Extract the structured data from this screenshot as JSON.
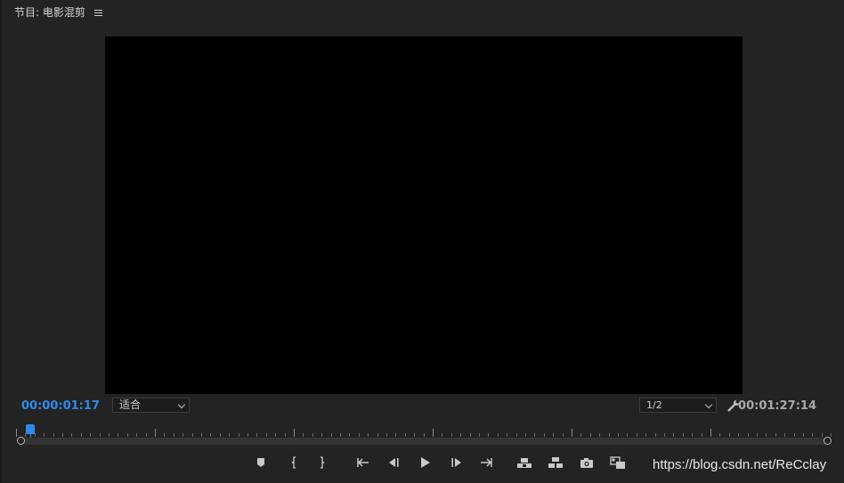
{
  "panel": {
    "title": "节目: 电影混剪",
    "menu_icon": "hamburger-menu-icon"
  },
  "timecodes": {
    "current": "00:00:01:17",
    "duration": "00:01:27:14",
    "current_color": "#2d8ceb",
    "duration_color": "#a9a9a9"
  },
  "zoom_select": {
    "value": "适合"
  },
  "resolution_select": {
    "value": "1/2"
  },
  "settings_icon": "wrench-icon",
  "transport": [
    {
      "name": "add-marker",
      "icon": "marker-icon"
    },
    {
      "name": "mark-in",
      "icon": "mark-in-icon"
    },
    {
      "name": "mark-out",
      "icon": "mark-out-icon"
    },
    {
      "name": "go-to-in",
      "icon": "go-to-in-icon"
    },
    {
      "name": "step-back",
      "icon": "step-back-icon"
    },
    {
      "name": "play",
      "icon": "play-icon"
    },
    {
      "name": "step-forward",
      "icon": "step-forward-icon"
    },
    {
      "name": "go-to-out",
      "icon": "go-to-out-icon"
    },
    {
      "name": "lift",
      "icon": "lift-icon"
    },
    {
      "name": "extract",
      "icon": "extract-icon"
    },
    {
      "name": "export-frame",
      "icon": "camera-icon"
    },
    {
      "name": "compare-view",
      "icon": "compare-icon"
    }
  ],
  "watermark": "https://blog.csdn.net/ReCclay",
  "colors": {
    "background": "#232323",
    "viewer": "#000000",
    "accent": "#2d8ceb"
  }
}
